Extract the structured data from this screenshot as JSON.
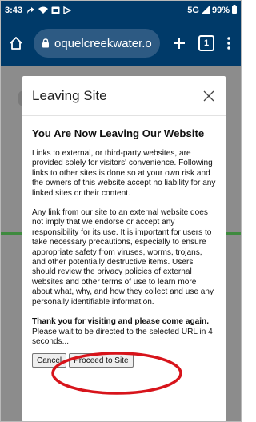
{
  "status_bar": {
    "time": "3:43",
    "network": "5G",
    "battery": "99%"
  },
  "browser": {
    "url": "oquelcreekwater.org",
    "tab_count": "1",
    "icons": [
      "home-icon",
      "lock-icon",
      "plus-icon",
      "tab-switcher-icon",
      "menu-icon"
    ]
  },
  "modal": {
    "title": "Leaving Site",
    "heading": "You Are Now Leaving Our Website",
    "paragraph_1": "Links to external, or third-party websites, are provided solely for visitors' convenience. Following links to other sites is done so at your own risk and the owners of this website accept no liability for any linked sites or their content.",
    "paragraph_2": "Any link from our site to an external website does not imply that we endorse or accept any responsibility for its use. It is important for users to take necessary precautions, especially to ensure appropriate safety from viruses, worms, trojans, and other potentially destructive items. Users should review the privacy policies of external websites and other terms of use to learn more about what, why, and how they collect and use any personally identifiable information.",
    "thanks": "Thank you for visiting and please come again.",
    "wait": "Please wait to be directed to the selected URL in 4 seconds...",
    "cancel_label": "Cancel",
    "proceed_label": "Proceed to Site"
  },
  "colors": {
    "browser_bar": "#003a69",
    "url_field": "#2d5a83",
    "overlay": "#8c8c8c",
    "annotation": "#d7141b"
  }
}
